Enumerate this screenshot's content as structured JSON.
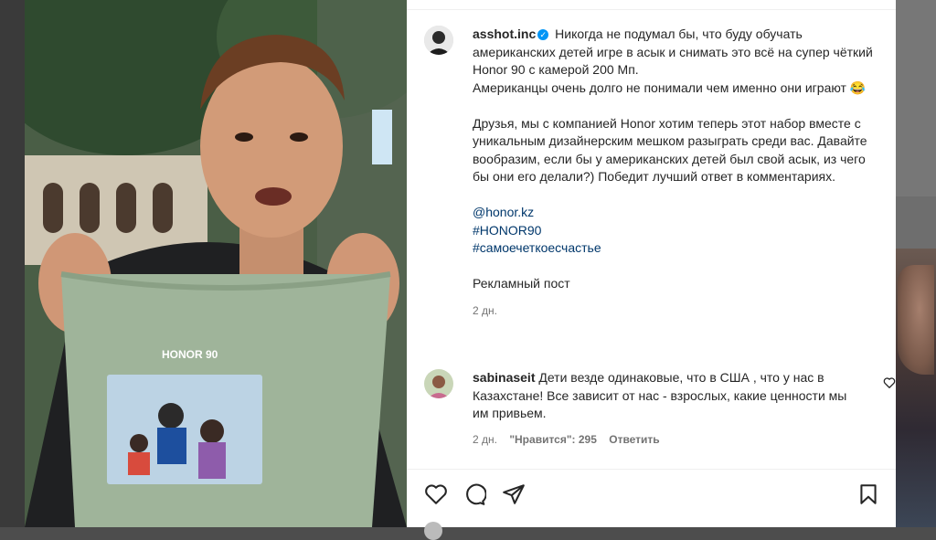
{
  "post": {
    "username": "asshot.inc",
    "caption_lines": [
      "Никогда не подумал бы, что буду обучать американских детей игре в асык и снимать это всё на супер чёткий Honor 90 с камерой 200 Мп.",
      "Американцы очень долго не понимали чем именно они играют 😂"
    ],
    "caption_paragraph2": "Друзья, мы с компанией Honor хотим теперь этот набор вместе с уникальным дизайнерским мешком разыграть среди вас. Давайте вообразим, если бы у американских детей был свой асык, из чего бы они его делали?) Победит лучший ответ в комментариях.",
    "links": [
      "@honor.kz",
      "#HONOR90",
      "#самоечеткоесчастье"
    ],
    "ad_label": "Рекламный пост",
    "time": "2 дн."
  },
  "media": {
    "bag_brand": "HONOR 90"
  },
  "comment": {
    "username": "sabinaseit",
    "text": "Дети везде одинаковые, что в США , что у нас в Казахстане! Все зависит от нас - взрослых, какие ценности мы им привьем.",
    "time": "2 дн.",
    "likes": "\"Нравится\": 295",
    "reply": "Ответить"
  },
  "icons": {
    "like": "heart-icon",
    "comment": "comment-bubble-icon",
    "share": "paper-plane-icon",
    "save": "bookmark-icon",
    "verified": "verified-badge-icon"
  },
  "colors": {
    "accent": "#0095f6",
    "link": "#00376b",
    "muted": "#737373"
  }
}
